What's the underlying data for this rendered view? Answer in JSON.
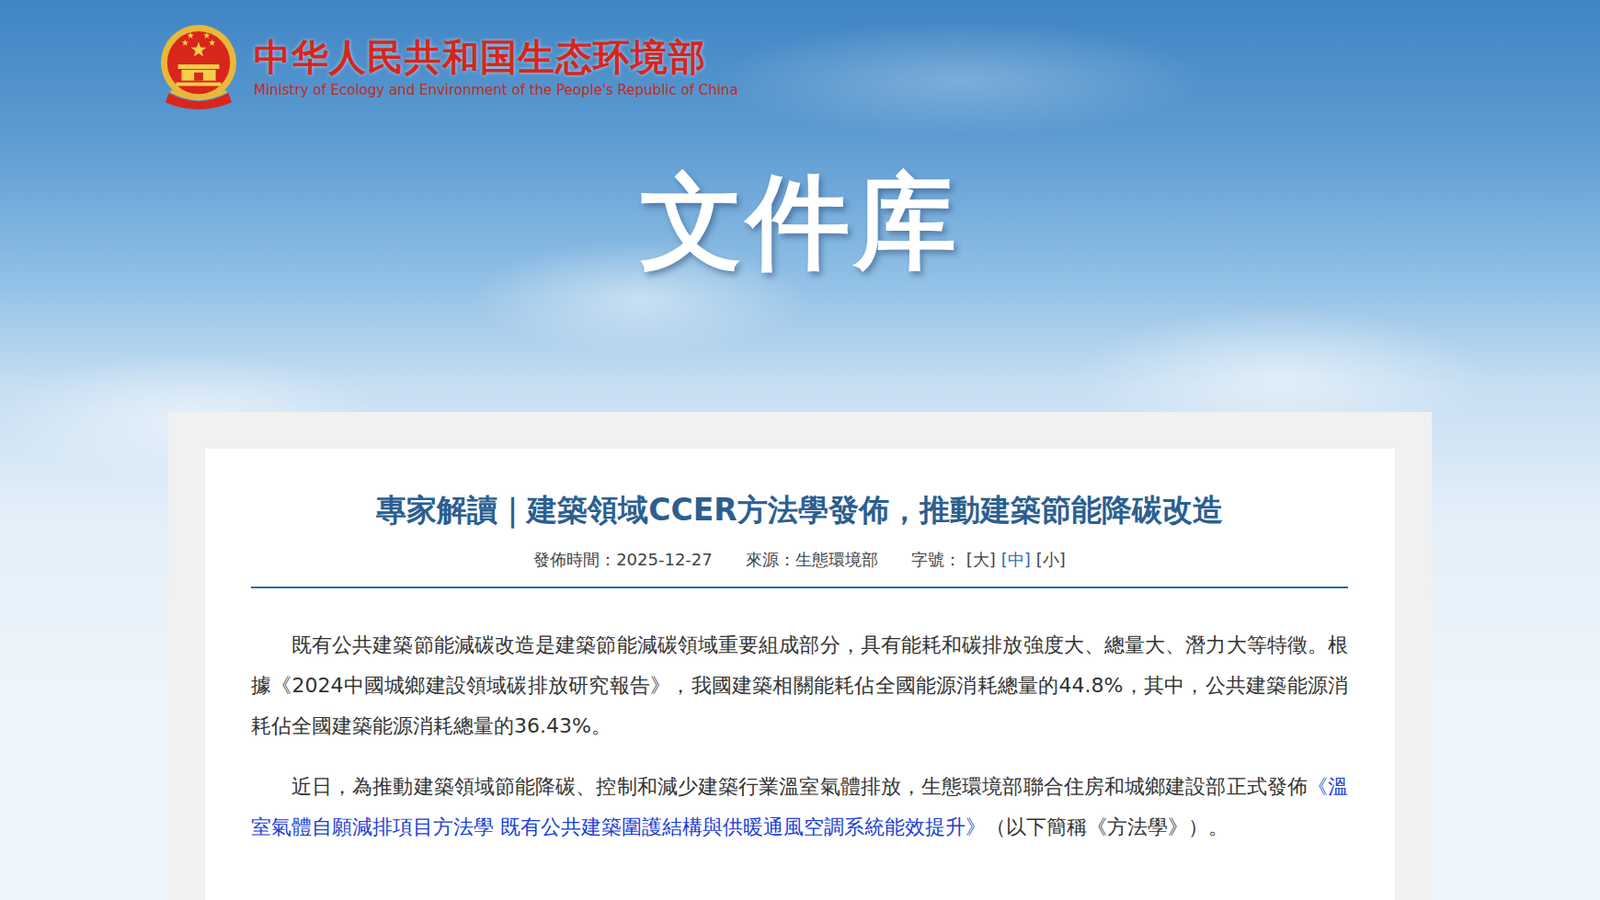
{
  "header": {
    "site_name": "中华人民共和国生态环境部",
    "site_name_en": "Ministry of Ecology and Environment of the People's Republic of China"
  },
  "banner": {
    "title": "文件库"
  },
  "article": {
    "title": "專家解讀｜建築領域CCER方法學發佈，推動建築節能降碳改造",
    "meta": {
      "date_label": "發佈時間：",
      "date": "2025-12-27",
      "source_label": "來源：",
      "source": "生態環境部",
      "size_label": "字號：",
      "sizes": [
        {
          "label": "[大]",
          "selected": false
        },
        {
          "label": "[中]",
          "selected": true
        },
        {
          "label": "[小]",
          "selected": false
        }
      ]
    },
    "paragraphs": [
      {
        "segments": [
          {
            "kind": "text",
            "text": "既有公共建築節能減碳改造是建築節能減碳領域重要組成部分，具有能耗和碳排放強度大、總量大、潛力大等特徵。根據《2024中國城鄉建設領域碳排放研究報告》，我國建築相關能耗佔全國能源消耗總量的44.8%，其中，公共建築能源消耗佔全國建築能源消耗總量的36.43%。"
          }
        ]
      },
      {
        "segments": [
          {
            "kind": "text",
            "text": "近日，為推動建築領域節能降碳、控制和減少建築行業溫室氣體排放，生態環境部聯合住房和城鄉建設部正式發佈"
          },
          {
            "kind": "link",
            "text": "《溫室氣體自願減排項目方法學 既有公共建築圍護結構與供暖通風空調系統能效提升》"
          },
          {
            "kind": "text",
            "text": "（以下簡稱《方法學》）。"
          }
        ]
      }
    ]
  }
}
